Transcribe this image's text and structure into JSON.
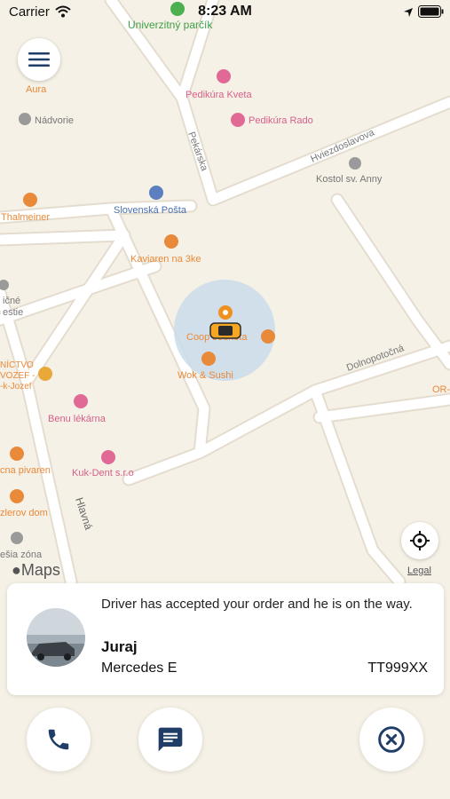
{
  "status_bar": {
    "carrier": "Carrier",
    "time": "8:23 AM"
  },
  "colors": {
    "accent": "#1f3d66",
    "poi_orange": "#e9893a",
    "poi_pink": "#e06a95",
    "poi_grey": "#9a9a9a",
    "map_bg": "#f6f1e6",
    "road": "#ffffff"
  },
  "map": {
    "streets": {
      "pekarska": "Pekárska",
      "hviezdoslavova": "Hviezdoslavova",
      "dolnopotocna": "Dolnopotočná",
      "hlavna": "Hlavná"
    },
    "pois": {
      "univerzitny": "Univerzitný parčík",
      "aura": "Aura",
      "nadvorie": "Nádvorie",
      "pedikura_kveta": "Pedikúra Kveta",
      "pedikura_rado": "Pedikúra Rado",
      "kostol": "Kostol sv. Anny",
      "thalmeiner": "Thalmeiner",
      "posta": "Slovenská Pošta",
      "kaviaren": "Kaviaren na 3ke",
      "icne": "ičné",
      "estie": "estie",
      "coop": "Coop Jednota",
      "wok": "Wok & Sushi",
      "nictvo": "NÍCTVO",
      "vozef": "VOZEF -",
      "k_jozef": "-k-Jozef",
      "benu": "Benu lékárna",
      "or": "OR-",
      "pivaren": "cna pivaren",
      "kukdent": "Kuk-Dent s.r.o",
      "zlerov": "zlerov dom",
      "zona": "ešia zóna"
    },
    "attribution": "Maps",
    "legal": "Legal"
  },
  "order_card": {
    "message": "Driver has accepted your order and he is on the way.",
    "driver_name": "Juraj",
    "car_model": "Mercedes E",
    "plate": "TT999XX"
  },
  "icons": {
    "menu": "hamburger-icon",
    "locate": "crosshair-icon",
    "call": "phone-icon",
    "chat": "message-icon",
    "cancel": "cancel-icon"
  }
}
